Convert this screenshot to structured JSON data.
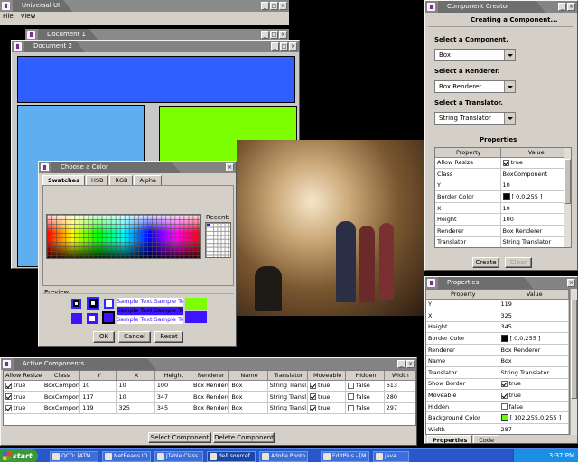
{
  "colors": {
    "blue": "#2f60ff",
    "lightblue": "#5eaef0",
    "green": "#7cff00",
    "purple": "#3c14ff"
  },
  "universal": {
    "title": "Universal UI",
    "menu": [
      "File",
      "View"
    ]
  },
  "doc1": {
    "title": "Document 1"
  },
  "doc2": {
    "title": "Document 2"
  },
  "chooser": {
    "title": "Choose a Color",
    "tabs": [
      "Swatches",
      "HSB",
      "RGB",
      "Alpha"
    ],
    "recent_label": "Recent:",
    "preview_label": "Preview",
    "sample": "Sample Text",
    "ok": "OK",
    "cancel": "Cancel",
    "reset": "Reset"
  },
  "creator": {
    "title": "Component Creator",
    "heading": "Creating a Component...",
    "select_component": "Select a Component.",
    "component": "Box",
    "select_renderer": "Select a Renderer.",
    "renderer": "Box Renderer",
    "select_translator": "Select a Translator.",
    "translator": "String Translator",
    "properties_label": "Properties",
    "headers": [
      "Property",
      "Value"
    ],
    "rows": [
      {
        "p": "Allow Resize",
        "v": "true",
        "t": "check"
      },
      {
        "p": "Class",
        "v": "BoxComponent"
      },
      {
        "p": "Y",
        "v": "10"
      },
      {
        "p": "Border Color",
        "v": "[ 0,0,255 ]",
        "t": "color",
        "c": "#000000"
      },
      {
        "p": "X",
        "v": "10"
      },
      {
        "p": "Height",
        "v": "100"
      },
      {
        "p": "Renderer",
        "v": "Box Renderer"
      },
      {
        "p": "Translator",
        "v": "String Translator"
      }
    ],
    "create": "Create",
    "clear": "Clear"
  },
  "props": {
    "title": "Properties",
    "headers": [
      "Property",
      "Value"
    ],
    "rows": [
      {
        "p": "Y",
        "v": "119"
      },
      {
        "p": "X",
        "v": "325"
      },
      {
        "p": "Height",
        "v": "345"
      },
      {
        "p": "Border Color",
        "v": "[ 0,0,255 ]",
        "t": "color",
        "c": "#000000"
      },
      {
        "p": "Renderer",
        "v": "Box Renderer"
      },
      {
        "p": "Name",
        "v": "Box"
      },
      {
        "p": "Translator",
        "v": "String Translator"
      },
      {
        "p": "Show Border",
        "v": "true",
        "t": "check"
      },
      {
        "p": "Moveable",
        "v": "true",
        "t": "check"
      },
      {
        "p": "Hidden",
        "v": "false",
        "t": "uncheck"
      },
      {
        "p": "Background Color",
        "v": "[ 102,255,0,255 ]",
        "t": "color",
        "c": "#66ff00"
      },
      {
        "p": "Width",
        "v": "287"
      }
    ],
    "tabs": [
      "Properties",
      "Code"
    ]
  },
  "active": {
    "title": "Active Components",
    "headers": [
      "Allow Resize",
      "Class",
      "Y",
      "X",
      "Height",
      "Renderer",
      "Name",
      "Translator",
      "Moveable",
      "Hidden",
      "Width"
    ],
    "rows": [
      [
        "true",
        "BoxCompon...",
        "10",
        "10",
        "100",
        "Box Renderer",
        "Box",
        "String Transl...",
        "true",
        "false",
        "613"
      ],
      [
        "true",
        "BoxCompon...",
        "117",
        "10",
        "347",
        "Box Renderer",
        "Box",
        "String Transl...",
        "true",
        "false",
        "280"
      ],
      [
        "true",
        "BoxCompon...",
        "119",
        "325",
        "345",
        "Box Renderer",
        "Box",
        "String Transl...",
        "true",
        "false",
        "297"
      ]
    ],
    "select_btn": "Select Component",
    "delete_btn": "Delete Component"
  },
  "taskbar": {
    "start": "start",
    "tasks": [
      "QCD: [ATM ...",
      "NetBeans ID...",
      "JTable Class...",
      "dell.sourcef...",
      "Adobe Photo...",
      "EditPlus - [M...",
      "java"
    ],
    "clock": "3:37 PM"
  }
}
